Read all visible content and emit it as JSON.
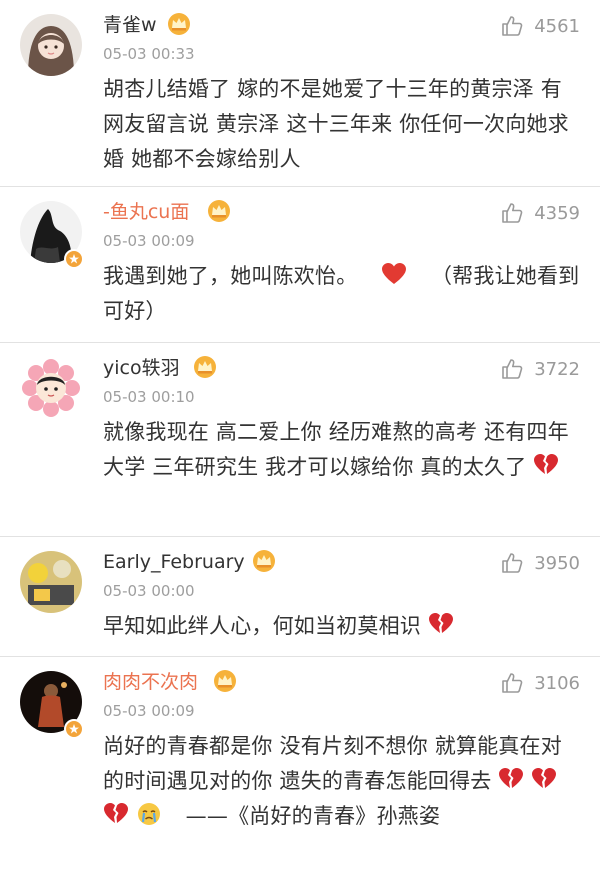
{
  "comments": [
    {
      "username": "青雀w",
      "time": "05-03 00:33",
      "likes": "4561",
      "text": "胡杏儿结婚了  嫁的不是她爱了十三年的黄宗泽  有网友留言说  黄宗泽  这十三年来  你任何一次向她求婚  她都不会嫁给别人"
    },
    {
      "username": "-鱼丸cu面",
      "time": "05-03 00:09",
      "likes": "4359",
      "text_before": "我遇到她了，她叫陈欢怡。",
      "text_after": "（帮我让她看到可好）"
    },
    {
      "username": "yico轶羽",
      "time": "05-03 00:10",
      "likes": "3722",
      "text": "就像我现在  高二爱上你  经历难熬的高考  还有四年大学  三年研究生  我才可以嫁给你  真的太久了"
    },
    {
      "username": "Early_February",
      "time": "05-03 00:00",
      "likes": "3950",
      "text": "早知如此绊人心，何如当初莫相识"
    },
    {
      "username": "肉肉不次肉",
      "time": "05-03 00:09",
      "likes": "3106",
      "text_before": "尚好的青春都是你 没有片刻不想你  就算能真在对的时间遇见对的你  遗失的青春怎能回得去",
      "text_after": "——《尚好的青春》孙燕姿"
    }
  ],
  "colors": {
    "username_default": "#333333",
    "username_highlight": "#eb7350",
    "meta_gray": "#9e9e9e",
    "divider": "#e2e2e2",
    "heart_red": "#e23a32",
    "verified_orange": "#f3a43a"
  },
  "icons": [
    "thumbs-up-icon",
    "crown-badge-icon",
    "verified-badge-icon",
    "red-heart-emoji",
    "broken-heart-emoji",
    "crying-face-emoji"
  ]
}
